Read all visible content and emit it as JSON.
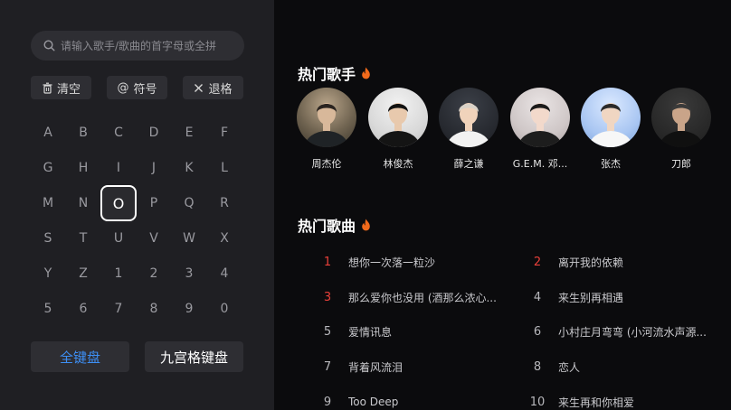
{
  "search": {
    "placeholder": "请输入歌手/歌曲的首字母或全拼"
  },
  "actions": {
    "clear": {
      "icon": "trash-icon",
      "label": "清空"
    },
    "symbol": {
      "icon": "at-icon",
      "label": "符号"
    },
    "backspace": {
      "icon": "close-icon",
      "label": "退格"
    }
  },
  "keyboard": {
    "rows": [
      [
        "A",
        "B",
        "C",
        "D",
        "E",
        "F"
      ],
      [
        "G",
        "H",
        "I",
        "J",
        "K",
        "L"
      ],
      [
        "M",
        "N",
        "O",
        "P",
        "Q",
        "R"
      ],
      [
        "S",
        "T",
        "U",
        "V",
        "W",
        "X"
      ],
      [
        "Y",
        "Z",
        "1",
        "2",
        "3",
        "4"
      ],
      [
        "5",
        "6",
        "7",
        "8",
        "9",
        "0"
      ]
    ],
    "selected": "O"
  },
  "modes": {
    "full": "全键盘",
    "nine": "九宫格键盘",
    "active": "full"
  },
  "hot_singers": {
    "title": "热门歌手",
    "items": [
      {
        "name": "周杰伦"
      },
      {
        "name": "林俊杰"
      },
      {
        "name": "薛之谦"
      },
      {
        "name": "G.E.M. 邓..."
      },
      {
        "name": "张杰"
      },
      {
        "name": "刀郎"
      }
    ]
  },
  "hot_songs": {
    "title": "热门歌曲",
    "items": [
      {
        "rank": "1",
        "title": "想你一次落一粒沙"
      },
      {
        "rank": "2",
        "title": "离开我的依赖"
      },
      {
        "rank": "3",
        "title": "那么爱你也没用 (酒那么浓心..."
      },
      {
        "rank": "4",
        "title": "来生别再相遇"
      },
      {
        "rank": "5",
        "title": "爱情讯息"
      },
      {
        "rank": "6",
        "title": "小村庄月弯弯 (小河流水声源..."
      },
      {
        "rank": "7",
        "title": "背着风流泪"
      },
      {
        "rank": "8",
        "title": "恋人"
      },
      {
        "rank": "9",
        "title": "Too Deep"
      },
      {
        "rank": "10",
        "title": "来生再和你相爱"
      }
    ]
  },
  "colors": {
    "accent": "#3d8ff5",
    "hot_rank": "#e8403a",
    "fire": "#f26a1b"
  }
}
